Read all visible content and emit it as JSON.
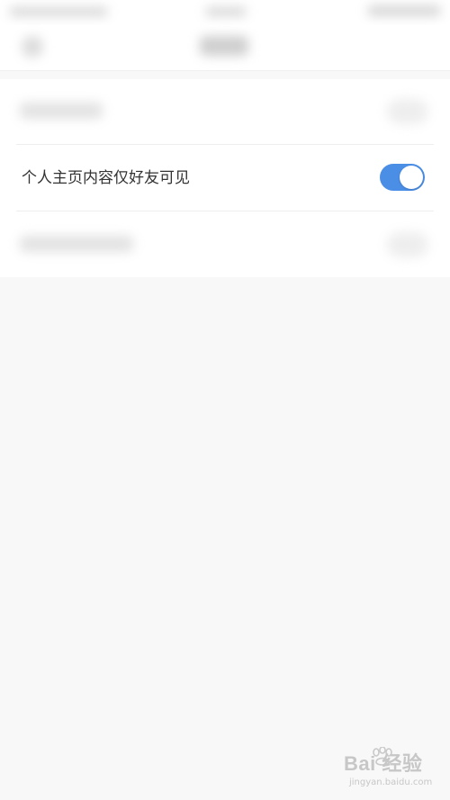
{
  "settings": {
    "friends_only_label": "个人主页内容仅好友可见",
    "friends_only_enabled": true
  },
  "colors": {
    "toggle_on": "#4a8ee6",
    "label_text": "#333333",
    "background": "#f8f8f8"
  },
  "watermark": {
    "brand": "Bai  经验",
    "url": "jingyan.baidu.com"
  }
}
